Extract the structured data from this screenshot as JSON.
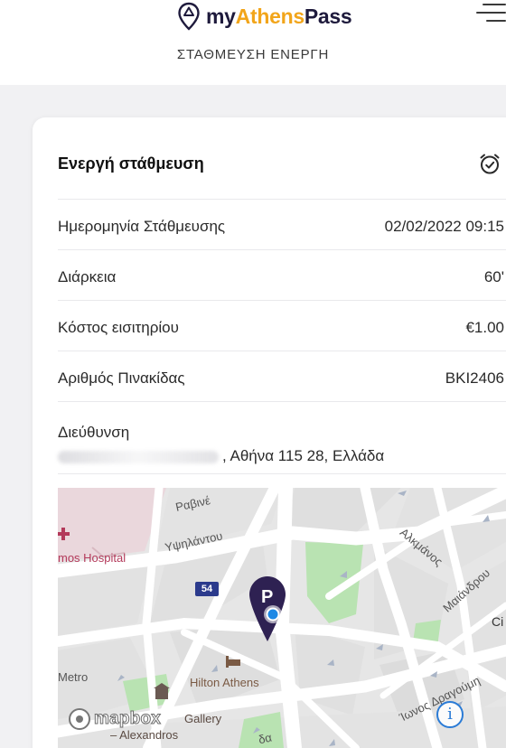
{
  "header": {
    "logo_prefix": "my",
    "logo_accent": "Athens",
    "logo_suffix": "Pass",
    "subtitle": "ΣΤΑΘΜΕΥΣΗ ΕΝΕΡΓΗ",
    "menu_icon": "hamburger-menu-icon",
    "brand_colors": {
      "dark": "#1e1a3c",
      "accent": "#f2a51a"
    }
  },
  "parking": {
    "title": "Ενεργή στάθμευση",
    "status_icon": "alarm-clock-icon",
    "rows": [
      {
        "label": "Ημερομηνία Στάθμευσης",
        "value": "02/02/2022 09:15"
      },
      {
        "label": "Διάρκεια",
        "value": "60'"
      },
      {
        "label": "Κόστος εισιτηρίου",
        "value": "€1.00"
      },
      {
        "label": "Αριθμός Πινακίδας",
        "value": "BKI2406"
      }
    ],
    "address": {
      "label": "Διεύθυνση",
      "value": ", Αθήνα 115 28, Ελλάδα"
    }
  },
  "map": {
    "labels": {
      "ravine": "Ραβινέ",
      "ypsilantou": "Υψηλάντου",
      "hospital": "mos Hospital",
      "alkmanos": "Αλκμάνος",
      "maiandrou": "Μαιάνδρου",
      "c": "Ci",
      "route": "54",
      "hilton": "Hilton Athens",
      "metro": "Metro",
      "gallery": "Gallery",
      "alexandros": "– Alexandros",
      "dragoumi": "Ίωνος Δραγούμη",
      "street_bottom": "δα"
    },
    "attribution": "mapbox",
    "info_label": "i",
    "pin_icon": "parking-location-pin-icon",
    "colors": {
      "pin": "#2e2152",
      "hospital": "#e8d3d8",
      "park": "#b9e3b2",
      "location_dot": "#1e88e5"
    }
  }
}
